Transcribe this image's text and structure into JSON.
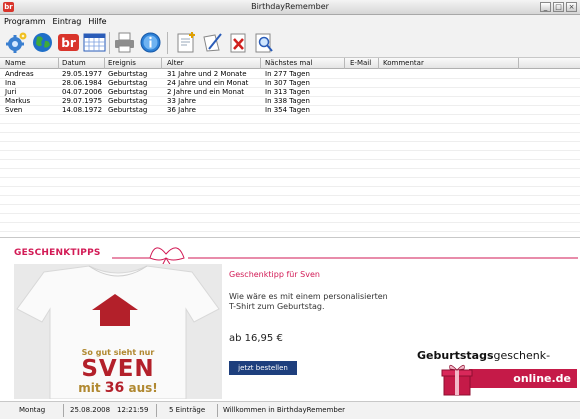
{
  "window": {
    "title": "BirthdayRemember",
    "app_icon_text": "br"
  },
  "menu": [
    "Programm",
    "Eintrag",
    "Hilfe"
  ],
  "toolbar": {
    "icons": [
      "settings-icon",
      "globe-icon",
      "br-logo-icon",
      "calendar-icon",
      "printer-icon",
      "info-icon",
      "new-entry-icon",
      "edit-entry-icon",
      "delete-entry-icon",
      "search-icon"
    ]
  },
  "list": {
    "columns": [
      "Name",
      "Datum",
      "Ereignis",
      "Alter",
      "Nächstes mal",
      "E-Mail",
      "Kommentar"
    ],
    "rows": [
      [
        "Andreas",
        "29.05.1977",
        "Geburtstag",
        "31 Jahre und 2 Monate",
        "In 277 Tagen",
        "",
        ""
      ],
      [
        "Ina",
        "28.06.1984",
        "Geburtstag",
        "24 Jahre und ein Monat",
        "In 307 Tagen",
        "",
        ""
      ],
      [
        "Juri",
        "04.07.2006",
        "Geburtstag",
        "2 Jahre und ein Monat",
        "In 313 Tagen",
        "",
        ""
      ],
      [
        "Markus",
        "29.07.1975",
        "Geburtstag",
        "33 Jahre",
        "In 338 Tagen",
        "",
        ""
      ],
      [
        "Sven",
        "14.08.1972",
        "Geburtstag",
        "36 Jahre",
        "In 354 Tagen",
        "",
        ""
      ]
    ]
  },
  "ad": {
    "heading": "GESCHENKTIPPS",
    "tipp_title": "Geschenktipp für Sven",
    "tipp_text": "Wie wäre es mit einem personalisierten T-Shirt zum Geburtstag.",
    "price": "ab 16,95 €",
    "order_button": "jetzt bestellen",
    "shirt_line1": "So gut sieht nur",
    "shirt_name": "SVEN",
    "shirt_line3_pre": "mit",
    "shirt_age": "36",
    "shirt_line3_post": "aus!",
    "brand_bold": "Geburtstags",
    "brand_normal": "geschenk-",
    "brand_domain": "online.de",
    "colors": {
      "accent": "#d21a55",
      "button": "#1e3f7d",
      "shirt_text": "#b08830",
      "shirt_name": "#b3202a"
    }
  },
  "status": {
    "day": "Montag",
    "date": "25.08.2008",
    "time": "12:21:59",
    "entries": "5 Einträge",
    "message": "Willkommen in BirthdayRemember"
  }
}
